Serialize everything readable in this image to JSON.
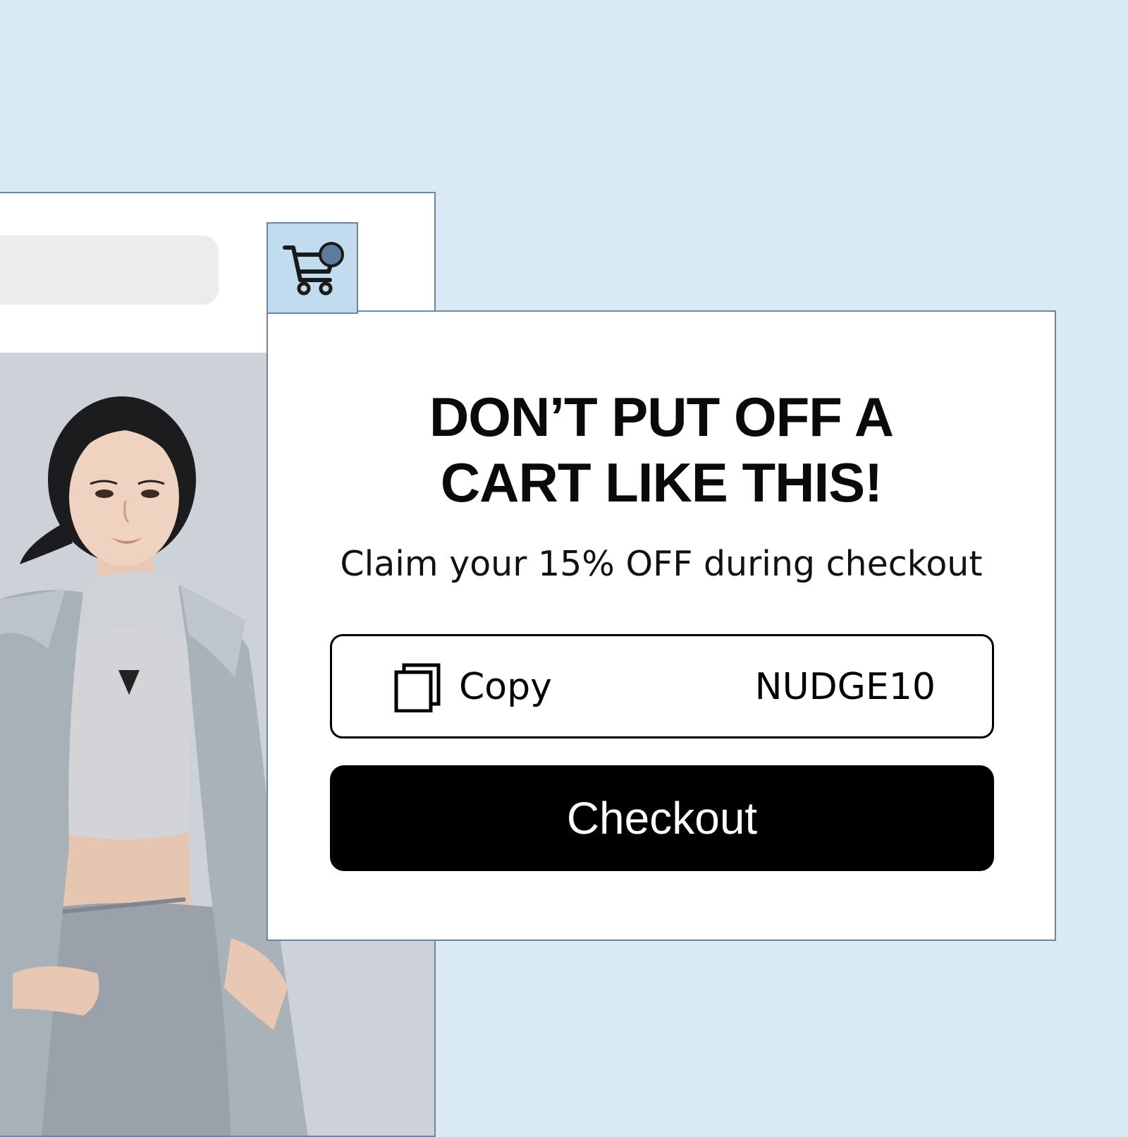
{
  "popup": {
    "title_line_1": "DON’T PUT OFF A",
    "title_line_2": "CART LIKE THIS!",
    "subtitle": "Claim your 15% OFF during checkout",
    "copy_label": "Copy",
    "coupon_code": "NUDGE10",
    "checkout_label": "Checkout"
  },
  "icons": {
    "cart": "shopping-cart-icon",
    "copy": "copy-icon"
  },
  "colors": {
    "page_background": "#d9eaf5",
    "window_border": "#6a86a3",
    "cart_button_background": "#c2dcef",
    "cart_badge": "#5b7c9e",
    "checkout_button": "#000000",
    "search_bar": "#ececec"
  }
}
